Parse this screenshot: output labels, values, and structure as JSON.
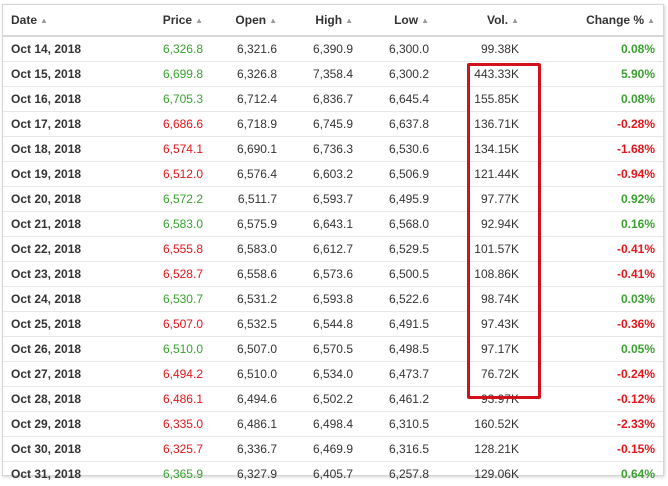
{
  "columns": [
    {
      "label": "Date",
      "sort_icon": "sort-arrows-icon"
    },
    {
      "label": "Price",
      "sort_icon": "sort-arrows-icon"
    },
    {
      "label": "Open",
      "sort_icon": "sort-arrows-icon"
    },
    {
      "label": "High",
      "sort_icon": "sort-arrows-icon"
    },
    {
      "label": "Low",
      "sort_icon": "sort-arrows-icon"
    },
    {
      "label": "Vol.",
      "sort_icon": "sort-arrows-icon"
    },
    {
      "label": "Change %",
      "sort_icon": "sort-arrows-icon"
    }
  ],
  "colors": {
    "up": "#3aa130",
    "down": "#e3161b",
    "highlight_box": "#d3111b"
  },
  "rows": [
    {
      "date": "Oct 14, 2018",
      "price": "6,326.8",
      "open": "6,321.6",
      "high": "6,390.9",
      "low": "6,300.0",
      "vol": "99.38K",
      "change": "0.08%",
      "trend": "up",
      "price_trend": "up"
    },
    {
      "date": "Oct 15, 2018",
      "price": "6,699.8",
      "open": "6,326.8",
      "high": "7,358.4",
      "low": "6,300.2",
      "vol": "443.33K",
      "change": "5.90%",
      "trend": "up",
      "price_trend": "up"
    },
    {
      "date": "Oct 16, 2018",
      "price": "6,705.3",
      "open": "6,712.4",
      "high": "6,836.7",
      "low": "6,645.4",
      "vol": "155.85K",
      "change": "0.08%",
      "trend": "up",
      "price_trend": "up"
    },
    {
      "date": "Oct 17, 2018",
      "price": "6,686.6",
      "open": "6,718.9",
      "high": "6,745.9",
      "low": "6,637.8",
      "vol": "136.71K",
      "change": "-0.28%",
      "trend": "down",
      "price_trend": "down"
    },
    {
      "date": "Oct 18, 2018",
      "price": "6,574.1",
      "open": "6,690.1",
      "high": "6,736.3",
      "low": "6,530.6",
      "vol": "134.15K",
      "change": "-1.68%",
      "trend": "down",
      "price_trend": "down"
    },
    {
      "date": "Oct 19, 2018",
      "price": "6,512.0",
      "open": "6,576.4",
      "high": "6,603.2",
      "low": "6,506.9",
      "vol": "121.44K",
      "change": "-0.94%",
      "trend": "down",
      "price_trend": "down"
    },
    {
      "date": "Oct 20, 2018",
      "price": "6,572.2",
      "open": "6,511.7",
      "high": "6,593.7",
      "low": "6,495.9",
      "vol": "97.77K",
      "change": "0.92%",
      "trend": "up",
      "price_trend": "up"
    },
    {
      "date": "Oct 21, 2018",
      "price": "6,583.0",
      "open": "6,575.9",
      "high": "6,643.1",
      "low": "6,568.0",
      "vol": "92.94K",
      "change": "0.16%",
      "trend": "up",
      "price_trend": "up"
    },
    {
      "date": "Oct 22, 2018",
      "price": "6,555.8",
      "open": "6,583.0",
      "high": "6,612.7",
      "low": "6,529.5",
      "vol": "101.57K",
      "change": "-0.41%",
      "trend": "down",
      "price_trend": "down"
    },
    {
      "date": "Oct 23, 2018",
      "price": "6,528.7",
      "open": "6,558.6",
      "high": "6,573.6",
      "low": "6,500.5",
      "vol": "108.86K",
      "change": "-0.41%",
      "trend": "down",
      "price_trend": "down"
    },
    {
      "date": "Oct 24, 2018",
      "price": "6,530.7",
      "open": "6,531.2",
      "high": "6,593.8",
      "low": "6,522.6",
      "vol": "98.74K",
      "change": "0.03%",
      "trend": "up",
      "price_trend": "up"
    },
    {
      "date": "Oct 25, 2018",
      "price": "6,507.0",
      "open": "6,532.5",
      "high": "6,544.8",
      "low": "6,491.5",
      "vol": "97.43K",
      "change": "-0.36%",
      "trend": "down",
      "price_trend": "down"
    },
    {
      "date": "Oct 26, 2018",
      "price": "6,510.0",
      "open": "6,507.0",
      "high": "6,570.5",
      "low": "6,498.5",
      "vol": "97.17K",
      "change": "0.05%",
      "trend": "up",
      "price_trend": "up"
    },
    {
      "date": "Oct 27, 2018",
      "price": "6,494.2",
      "open": "6,510.0",
      "high": "6,534.0",
      "low": "6,473.7",
      "vol": "76.72K",
      "change": "-0.24%",
      "trend": "down",
      "price_trend": "down"
    },
    {
      "date": "Oct 28, 2018",
      "price": "6,486.1",
      "open": "6,494.6",
      "high": "6,502.2",
      "low": "6,461.2",
      "vol": "93.97K",
      "change": "-0.12%",
      "trend": "down",
      "price_trend": "down"
    },
    {
      "date": "Oct 29, 2018",
      "price": "6,335.0",
      "open": "6,486.1",
      "high": "6,498.4",
      "low": "6,310.5",
      "vol": "160.52K",
      "change": "-2.33%",
      "trend": "down",
      "price_trend": "down"
    },
    {
      "date": "Oct 30, 2018",
      "price": "6,325.7",
      "open": "6,336.7",
      "high": "6,469.9",
      "low": "6,316.5",
      "vol": "128.21K",
      "change": "-0.15%",
      "trend": "down",
      "price_trend": "down"
    },
    {
      "date": "Oct 31, 2018",
      "price": "6,365.9",
      "open": "6,327.9",
      "high": "6,405.7",
      "low": "6,257.8",
      "vol": "129.06K",
      "change": "0.64%",
      "trend": "up",
      "price_trend": "up"
    }
  ]
}
